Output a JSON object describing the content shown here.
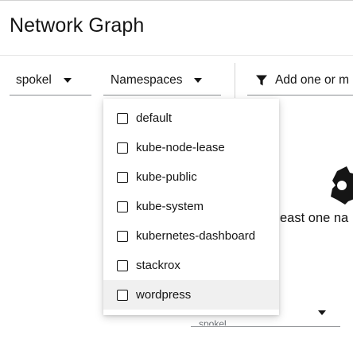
{
  "page": {
    "title": "Network Graph"
  },
  "toolbar": {
    "cluster_value": "spokel",
    "namespaces_label": "Namespaces",
    "filter_placeholder": "Add one or m"
  },
  "graph": {
    "empty_text": "east one na",
    "bottom_select_text": "spokel"
  },
  "namespace_menu": {
    "items": [
      {
        "label": "default",
        "checked": false
      },
      {
        "label": "kube-node-lease",
        "checked": false
      },
      {
        "label": "kube-public",
        "checked": false
      },
      {
        "label": "kube-system",
        "checked": false
      },
      {
        "label": "kubernetes-dashboard",
        "checked": false
      },
      {
        "label": "stackrox",
        "checked": false
      },
      {
        "label": "wordpress",
        "checked": false
      }
    ],
    "hovered_item": "wordpress"
  },
  "icons": {
    "filter": "filter-icon",
    "caret": "caret-down-icon",
    "graph_placeholder": "network-gear-icon"
  }
}
